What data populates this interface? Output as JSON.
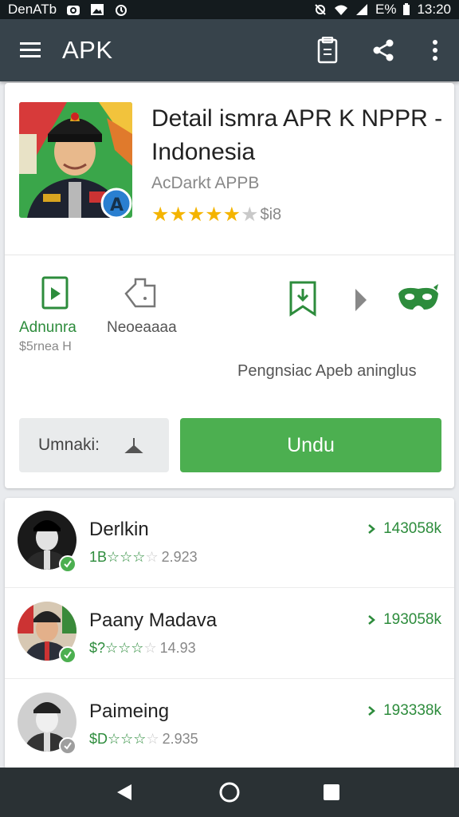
{
  "status_bar": {
    "left_text": "DenATb",
    "battery": "E%",
    "time": "13:20"
  },
  "appbar": {
    "title": "APK"
  },
  "app": {
    "title": "Detail ismra APR K NPPR - Indonesia",
    "developer": "AcDarkt APPB",
    "rating_stars": 5,
    "rating_count": "$i8"
  },
  "features": [
    {
      "label": "Adnunra",
      "sub": "$5rnea H",
      "icon": "file-icon"
    },
    {
      "label": "Neoeaaaa",
      "sub": "",
      "icon": "tag-icon"
    },
    {
      "label": "",
      "sub": "",
      "icon": "bookmark-download-icon"
    },
    {
      "label": "",
      "sub": "",
      "icon": "chevron-right-icon"
    },
    {
      "label": "",
      "sub": "",
      "icon": "mask-icon"
    }
  ],
  "feature_desc": "Pengnsiac Apeb aninglus",
  "buttons": {
    "secondary_label": "Umnaki:",
    "primary_label": "Undu"
  },
  "list": [
    {
      "name": "Derlkin",
      "lead": "1B",
      "count": "2.923",
      "right": "143058k"
    },
    {
      "name": "Paany Madava",
      "lead": "$?",
      "count": "14.93",
      "right": "193058k"
    },
    {
      "name": "Paimeing",
      "lead": "$D",
      "count": "2.935",
      "right": "193338k"
    }
  ],
  "nav": {
    "extra": ""
  },
  "colors": {
    "accent": "#4caf50",
    "appbar": "#37434b",
    "star": "#f4b400"
  }
}
